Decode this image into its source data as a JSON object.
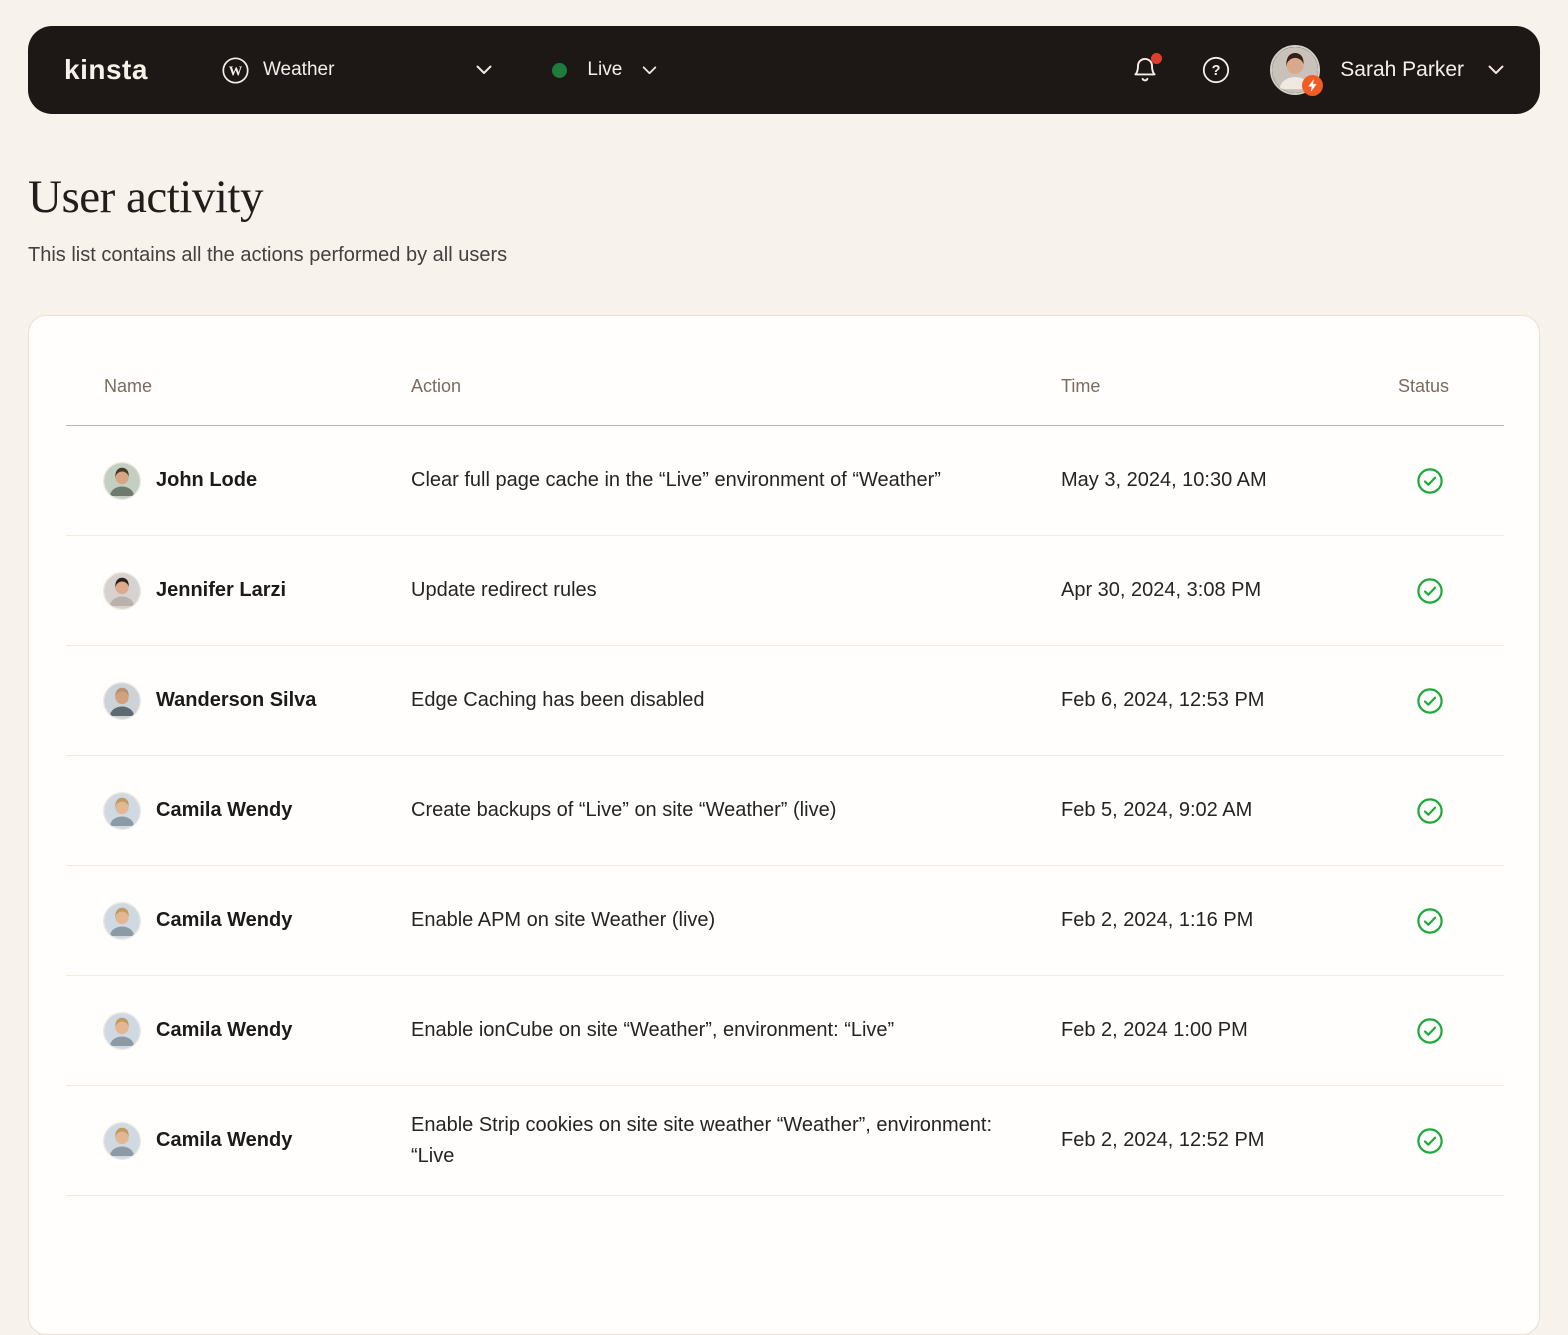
{
  "colors": {
    "status_green": "#1ea93c",
    "env_green": "#1f7c3d",
    "alert_red": "#e03e2d",
    "badge_orange": "#f05c22"
  },
  "navbar": {
    "logo": "kinsta",
    "site_selector": {
      "label": "Weather",
      "icon": "wordpress"
    },
    "env_selector": {
      "label": "Live",
      "status": "online"
    },
    "user": {
      "name": "Sarah Parker",
      "avatar": {
        "bg": "#c9c2bb",
        "skin": "#d9a98c",
        "hair": "#332018",
        "shirt": "#efe9e2"
      }
    }
  },
  "page": {
    "title": "User activity",
    "subtitle": "This list contains all the actions performed by all users"
  },
  "table": {
    "headers": {
      "name": "Name",
      "action": "Action",
      "time": "Time",
      "status": "Status"
    },
    "rows": [
      {
        "name": "John Lode",
        "action": "Clear full page cache in the “Live” environment of “Weather”",
        "time": "May 3, 2024, 10:30 AM",
        "status": "success",
        "avatar": {
          "bg": "#c3cfc3",
          "skin": "#d7a583",
          "hair": "#4a382c",
          "shirt": "#6d7a6d"
        }
      },
      {
        "name": "Jennifer Larzi",
        "action": "Update redirect rules",
        "time": "Apr 30, 2024, 3:08 PM",
        "status": "success",
        "avatar": {
          "bg": "#d6d2d0",
          "skin": "#dcab8b",
          "hair": "#2c211c",
          "shirt": "#b9b2ac"
        }
      },
      {
        "name": "Wanderson Silva",
        "action": "Edge Caching has been disabled",
        "time": "Feb 6, 2024, 12:53 PM",
        "status": "success",
        "avatar": {
          "bg": "#ccd3d8",
          "skin": "#d2a17e",
          "hair": "#bb9070",
          "shirt": "#5d6a72"
        }
      },
      {
        "name": "Camila Wendy",
        "action": "Create backups of “Live” on site “Weather” (live)",
        "time": "Feb 5, 2024, 9:02 AM",
        "status": "success",
        "avatar": {
          "bg": "#cfd9e2",
          "skin": "#e3b694",
          "hair": "#c09a5e",
          "shirt": "#8c9aa6"
        }
      },
      {
        "name": "Camila Wendy",
        "action": "Enable APM on site Weather (live)",
        "time": "Feb 2, 2024, 1:16 PM",
        "status": "success",
        "avatar": {
          "bg": "#cfd9e2",
          "skin": "#e3b694",
          "hair": "#c09a5e",
          "shirt": "#8c9aa6"
        }
      },
      {
        "name": "Camila Wendy",
        "action": "Enable ionCube on site “Weather”, environment: “Live”",
        "time": "Feb 2, 2024 1:00 PM",
        "status": "success",
        "avatar": {
          "bg": "#cfd9e2",
          "skin": "#e3b694",
          "hair": "#c09a5e",
          "shirt": "#8c9aa6"
        }
      },
      {
        "name": "Camila Wendy",
        "action": "Enable Strip cookies on site site weather “Weather”, environment: “Live",
        "time": "Feb 2, 2024, 12:52 PM",
        "status": "success",
        "avatar": {
          "bg": "#cfd9e2",
          "skin": "#e3b694",
          "hair": "#c09a5e",
          "shirt": "#8c9aa6"
        }
      }
    ]
  }
}
